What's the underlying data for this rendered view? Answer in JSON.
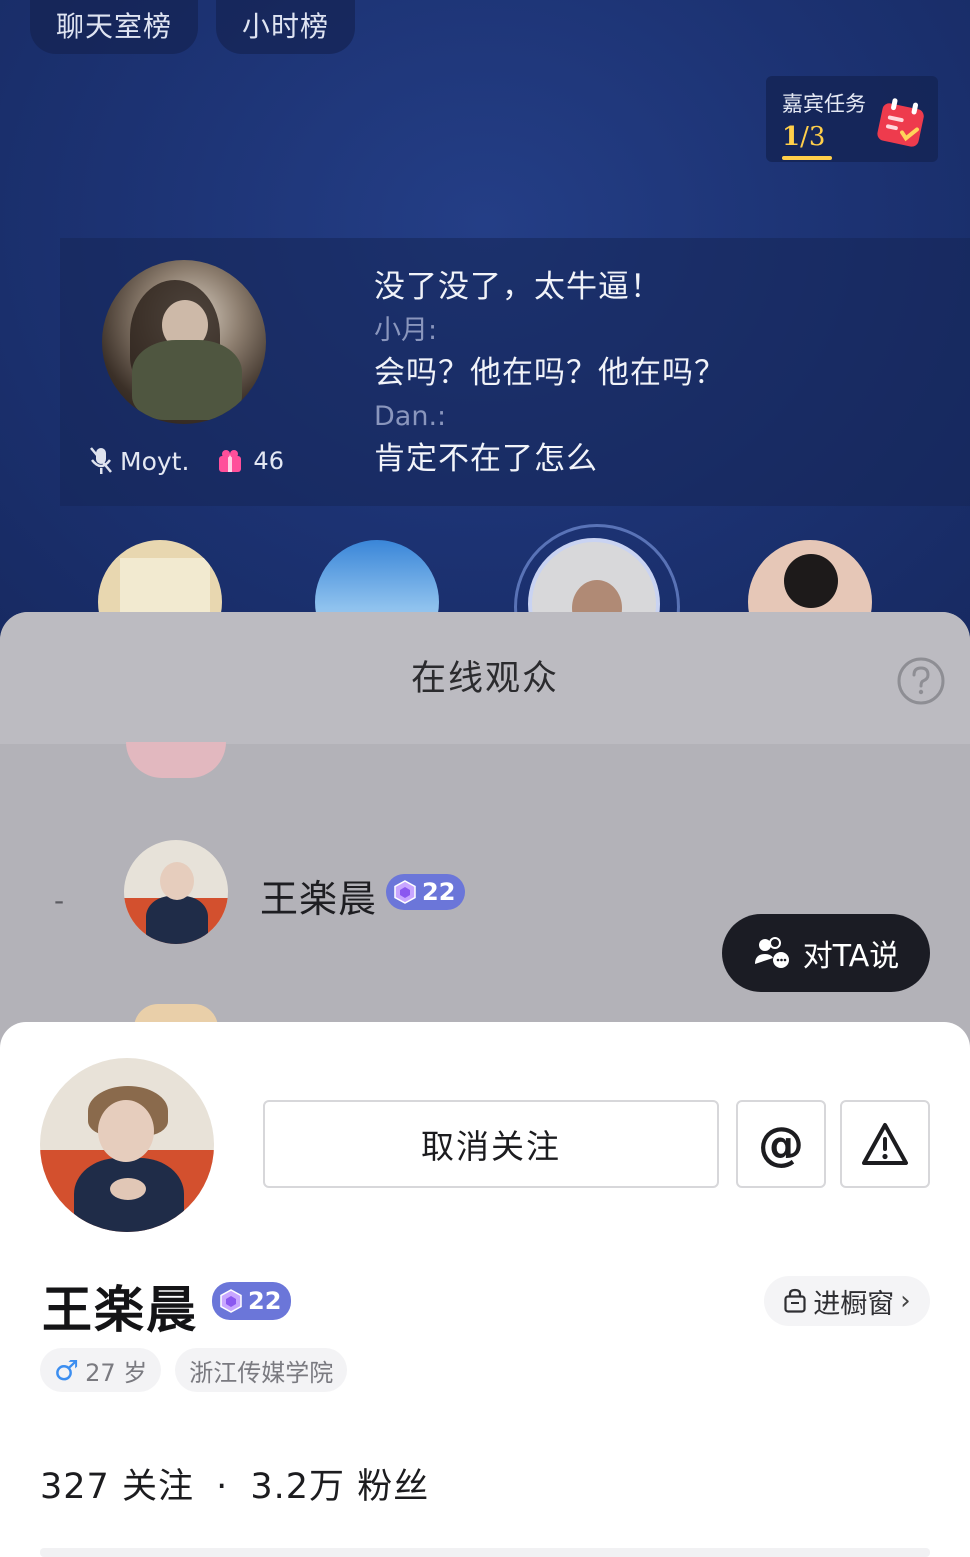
{
  "top_tabs": [
    "聊天室榜",
    "小时榜"
  ],
  "guest_task": {
    "label": "嘉宾任务",
    "done": "1",
    "total": "/3"
  },
  "host": {
    "name": "Moyt.",
    "gift_count": "46"
  },
  "chat": [
    {
      "kind": "msg",
      "text": "没了没了，太牛逼！"
    },
    {
      "kind": "who",
      "text": "小月:"
    },
    {
      "kind": "msg",
      "text": "会吗？他在吗？他在吗？"
    },
    {
      "kind": "who",
      "text": "Dan.:"
    },
    {
      "kind": "msg",
      "text": "肯定不在了怎么"
    }
  ],
  "audience_sheet": {
    "title": "在线观众",
    "row": {
      "rank": "-",
      "name": "王楽晨",
      "level": "22"
    },
    "talk_button": "对TA说"
  },
  "profile": {
    "unfollow_label": "取消关注",
    "at_label": "@",
    "name": "王楽晨",
    "level": "22",
    "showcase_label": "进橱窗",
    "age": "27 岁",
    "school": "浙江传媒学院",
    "following": "327",
    "following_label": "关注",
    "separator": "·",
    "fans": "3.2万",
    "fans_label": "粉丝"
  },
  "colors": {
    "room_bg": "#1c3272",
    "task_gold": "#ffcf4a",
    "level_badge": "#6b76d9",
    "talk_button_bg": "#1b1c24",
    "male_blue": "#3c8ef0"
  }
}
